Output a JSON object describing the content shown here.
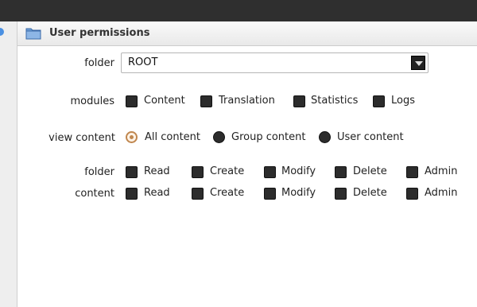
{
  "panel": {
    "title": "User permissions"
  },
  "folder_select": {
    "label": "folder",
    "value": "ROOT"
  },
  "modules": {
    "label": "modules",
    "options": [
      {
        "label": "Content",
        "checked": false
      },
      {
        "label": "Translation",
        "checked": false
      },
      {
        "label": "Statistics",
        "checked": false
      },
      {
        "label": "Logs",
        "checked": false
      }
    ]
  },
  "view_content": {
    "label": "view content",
    "options": [
      {
        "label": "All content",
        "selected": true
      },
      {
        "label": "Group content",
        "selected": false
      },
      {
        "label": "User content",
        "selected": false
      }
    ]
  },
  "permissions": {
    "rows": [
      {
        "label": "folder",
        "options": [
          "Read",
          "Create",
          "Modify",
          "Delete",
          "Admin"
        ]
      },
      {
        "label": "content",
        "options": [
          "Read",
          "Create",
          "Modify",
          "Delete",
          "Admin"
        ]
      }
    ]
  }
}
